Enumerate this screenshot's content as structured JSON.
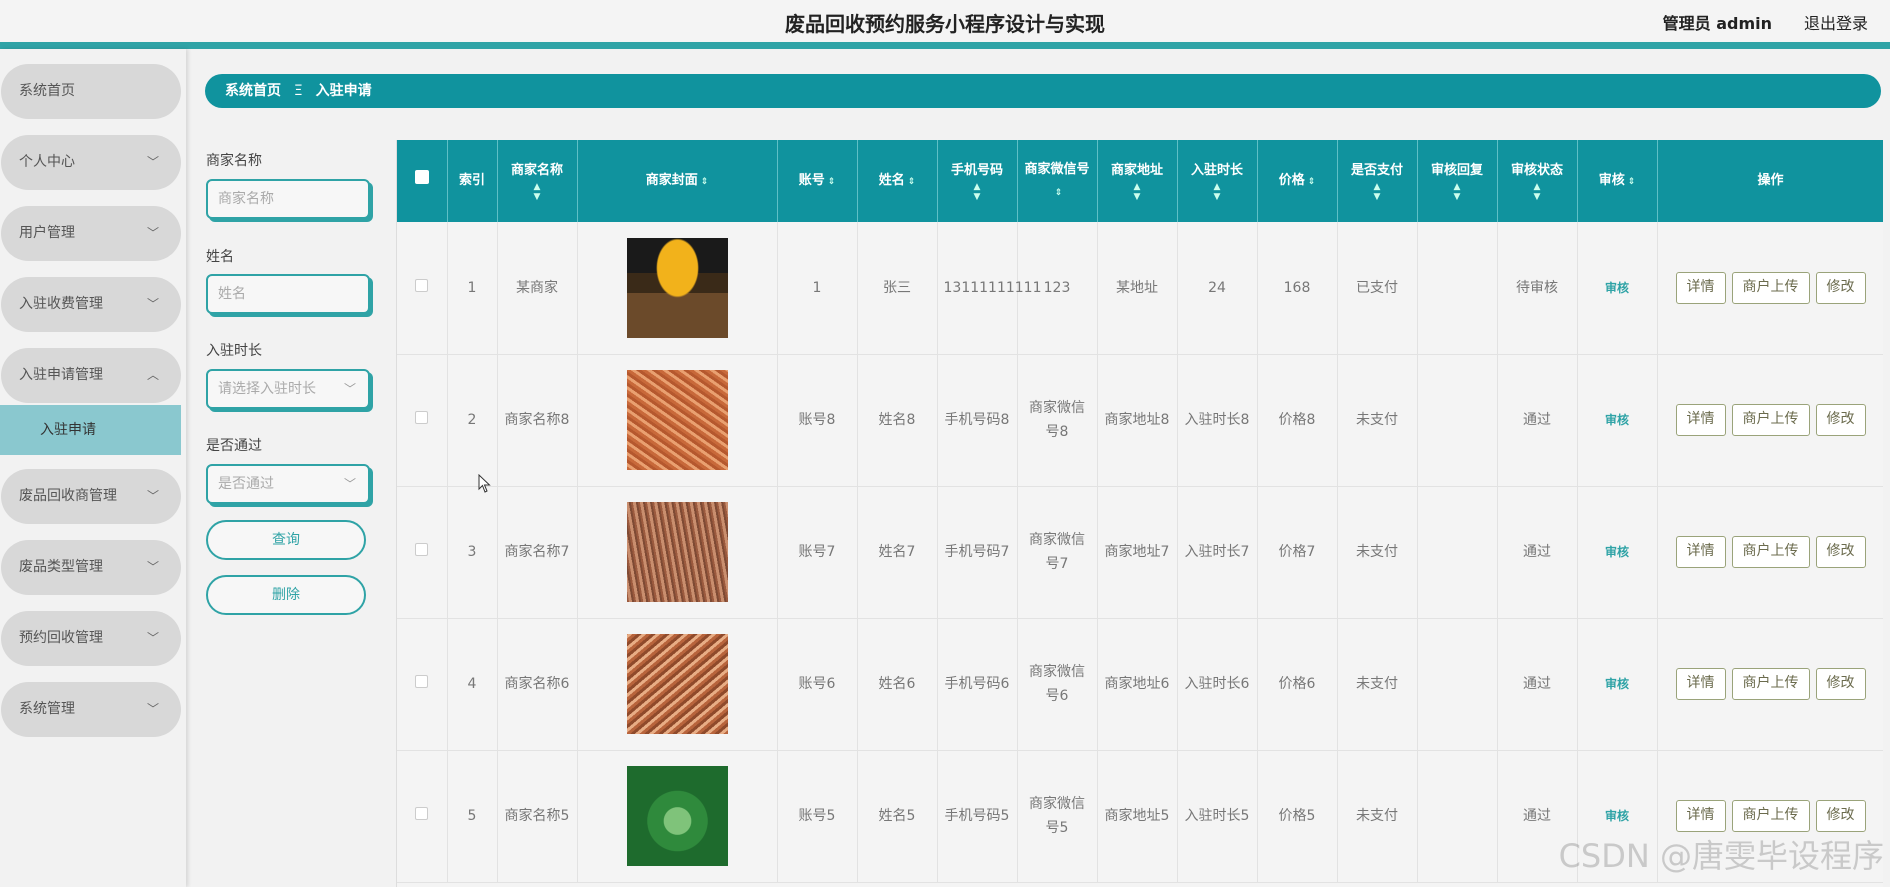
{
  "header": {
    "title": "废品回收预约服务小程序设计与实现",
    "user": "管理员 admin",
    "logout": "退出登录"
  },
  "sidebar": {
    "items": [
      {
        "label": "系统首页",
        "chevron": ""
      },
      {
        "label": "个人中心",
        "chevron": "﹀"
      },
      {
        "label": "用户管理",
        "chevron": "﹀"
      },
      {
        "label": "入驻收费管理",
        "chevron": "﹀"
      },
      {
        "label": "入驻申请管理",
        "chevron": "︿"
      },
      {
        "label": "废品回收商管理",
        "chevron": "﹀"
      },
      {
        "label": "废品类型管理",
        "chevron": "﹀"
      },
      {
        "label": "预约回收管理",
        "chevron": "﹀"
      },
      {
        "label": "系统管理",
        "chevron": "﹀"
      }
    ],
    "submenu": "入驻申请"
  },
  "breadcrumb": {
    "home": "系统首页",
    "separator": "Ξ",
    "current": "入驻申请"
  },
  "filters": {
    "merchant_name_label": "商家名称",
    "merchant_name_placeholder": "商家名称",
    "name_label": "姓名",
    "name_placeholder": "姓名",
    "duration_label": "入驻时长",
    "duration_placeholder": "请选择入驻时长",
    "approved_label": "是否通过",
    "approved_placeholder": "是否通过",
    "query_button": "查询",
    "delete_button": "删除"
  },
  "table": {
    "headers": {
      "index": "索引",
      "merchant_name": "商家名称",
      "cover": "商家封面",
      "account": "账号",
      "name": "姓名",
      "phone": "手机号码",
      "wechat": "商家微信号",
      "address": "商家地址",
      "duration": "入驻时长",
      "price": "价格",
      "paid": "是否支付",
      "reply": "审核回复",
      "status": "审核状态",
      "audit": "审核",
      "ops": "操作"
    },
    "rows": [
      {
        "index": "1",
        "merchant_name": "某商家",
        "cover": "store-front",
        "account": "1",
        "name": "张三",
        "phone": "13111111111",
        "wechat": "123",
        "address": "某地址",
        "duration": "24",
        "price": "168",
        "paid": "已支付",
        "reply": "",
        "status": "待审核",
        "audit": "审核"
      },
      {
        "index": "2",
        "merchant_name": "商家名称8",
        "cover": "copper-wire",
        "account": "账号8",
        "name": "姓名8",
        "phone": "手机号码8",
        "wechat": "商家微信号8",
        "address": "商家地址8",
        "duration": "入驻时长8",
        "price": "价格8",
        "paid": "未支付",
        "reply": "",
        "status": "通过",
        "audit": "审核"
      },
      {
        "index": "3",
        "merchant_name": "商家名称7",
        "cover": "copper-scrap",
        "account": "账号7",
        "name": "姓名7",
        "phone": "手机号码7",
        "wechat": "商家微信号7",
        "address": "商家地址7",
        "duration": "入驻时长7",
        "price": "价格7",
        "paid": "未支付",
        "reply": "",
        "status": "通过",
        "audit": "审核"
      },
      {
        "index": "4",
        "merchant_name": "商家名称6",
        "cover": "copper-pile",
        "account": "账号6",
        "name": "姓名6",
        "phone": "手机号码6",
        "wechat": "商家微信号6",
        "address": "商家地址6",
        "duration": "入驻时长6",
        "price": "价格6",
        "paid": "未支付",
        "reply": "",
        "status": "通过",
        "audit": "审核"
      },
      {
        "index": "5",
        "merchant_name": "商家名称5",
        "cover": "recycle-green",
        "account": "账号5",
        "name": "姓名5",
        "phone": "手机号码5",
        "wechat": "商家微信号5",
        "address": "商家地址5",
        "duration": "入驻时长5",
        "price": "价格5",
        "paid": "未支付",
        "reply": "",
        "status": "通过",
        "audit": "审核"
      }
    ],
    "op_labels": {
      "detail": "详情",
      "upload": "商户上传",
      "edit": "修改"
    }
  },
  "watermark": "CSDN @唐雯毕设程序",
  "colors": {
    "accent": "#10939e",
    "accent_light": "#2fa3a6",
    "submenu_bg": "#8ac8cf"
  }
}
